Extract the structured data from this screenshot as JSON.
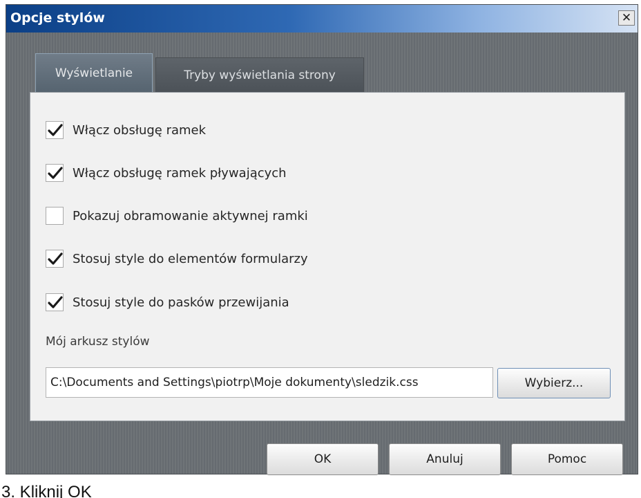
{
  "window": {
    "title": "Opcje stylów",
    "close_glyph": "✕"
  },
  "tabs": [
    {
      "label": "Wyświetlanie",
      "active": true
    },
    {
      "label": "Tryby wyświetlania strony",
      "active": false
    }
  ],
  "options": [
    {
      "label": "Włącz obsługę ramek",
      "checked": true
    },
    {
      "label": "Włącz obsługę ramek pływających",
      "checked": true
    },
    {
      "label": "Pokazuj obramowanie aktywnej ramki",
      "checked": false
    },
    {
      "label": "Stosuj style do elementów formularzy",
      "checked": true
    },
    {
      "label": "Stosuj style do pasków przewijania",
      "checked": true
    }
  ],
  "stylesheet": {
    "label": "Mój arkusz stylów",
    "path": "C:\\Documents and Settings\\piotrp\\Moje dokumenty\\sledzik.css",
    "browse_label": "Wybierz..."
  },
  "buttons": {
    "ok": "OK",
    "cancel": "Anuluj",
    "help": "Pomoc"
  },
  "caption": "3. Kliknij OK",
  "colors": {
    "titlebar_start": "#0b3f86",
    "titlebar_end": "#d6e3f4",
    "panel_bg": "#f1f1f1",
    "dialog_bg": "#6f7478"
  },
  "icons": {
    "check": "checkmark-icon",
    "close": "close-icon"
  }
}
